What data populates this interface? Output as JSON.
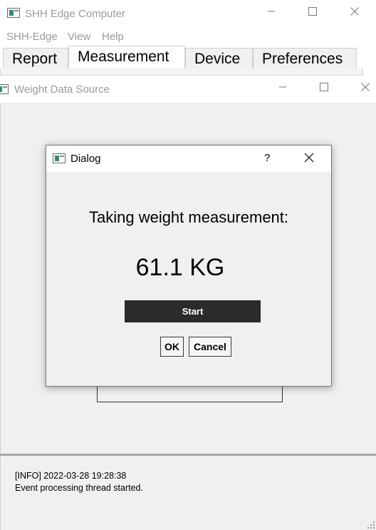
{
  "main_window": {
    "title": "SHH Edge Computer",
    "controls": {
      "minimize": "—",
      "maximize": "☐",
      "close": "✕"
    }
  },
  "menubar": {
    "items": [
      "SHH-Edge",
      "View",
      "Help"
    ]
  },
  "tabs": [
    {
      "label": "Report",
      "active": false
    },
    {
      "label": "Measurement",
      "active": true
    },
    {
      "label": "Device",
      "active": false
    },
    {
      "label": "Preferences",
      "active": false
    }
  ],
  "sub_window": {
    "title": "Weight Data Source",
    "controls": {
      "minimize": "—",
      "maximize": "☐",
      "close": "✕"
    }
  },
  "dialog": {
    "title": "Dialog",
    "help": "?",
    "close": "✕",
    "message": "Taking weight measurement:",
    "weight": "61.1 KG",
    "start_label": "Start",
    "ok_label": "OK",
    "cancel_label": "Cancel"
  },
  "log": {
    "lines": [
      "[INFO] 2022-03-28 19:28:38",
      "Event processing thread started."
    ]
  }
}
